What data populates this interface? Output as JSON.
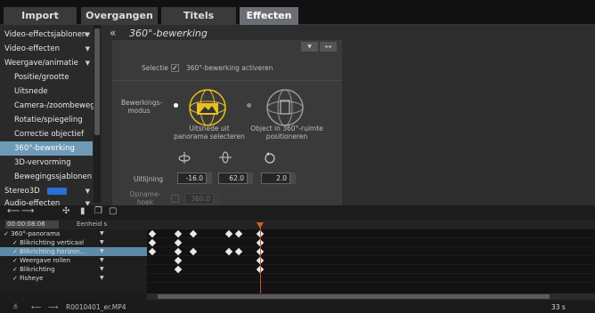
{
  "tabs": [
    "Import",
    "Overgangen",
    "Titels",
    "Effecten"
  ],
  "sidebar": {
    "items": [
      {
        "label": "Video-effectsjablonen",
        "arrow": "▼"
      },
      {
        "label": "Video-effecten",
        "arrow": "▼"
      },
      {
        "label": "Weergave/animatie",
        "arrow": "▼"
      },
      {
        "label": "Positie/grootte"
      },
      {
        "label": "Uitsnede"
      },
      {
        "label": "Camera-/zoombeweg."
      },
      {
        "label": "Rotatie/spiegeling"
      },
      {
        "label": "Correctie objectief"
      },
      {
        "label": "360°-bewerking",
        "selected": true
      },
      {
        "label": "3D-vervorming"
      },
      {
        "label": "Bewegingssjablonen"
      },
      {
        "label": "Stereo3D",
        "arrow": "▼"
      },
      {
        "label": "Audio-effecten",
        "arrow": "▼"
      }
    ]
  },
  "panel": {
    "collapse_glyph": "«",
    "title": "360°-bewerking",
    "selectie_label": "Selectie",
    "activate_label": "360°-bewerking activeren",
    "mode_label": "Bewerkings-\nmodus",
    "option1": "Uitsnede uit\npanorama selecteren",
    "option2": "Object in 360°-ruimte\npositioneren",
    "uitlijning_label": "Uitlijning",
    "values": [
      "-16.0",
      "62.0",
      "2.0"
    ],
    "opname_label": "Opname-\nhoek",
    "opname_value": "360.0"
  },
  "timeline": {
    "time": "00:00:08:06",
    "unit_label": "Eenheid",
    "unit_value": "s",
    "rows": [
      {
        "label": "360°-panorama",
        "level": 0
      },
      {
        "label": "Blikrichting verticaal",
        "level": 1
      },
      {
        "label": "Blikrichting horizon...",
        "level": 1,
        "selected": true
      },
      {
        "label": "Weergave rollen",
        "level": 1
      },
      {
        "label": "Blikrichting",
        "level": 1
      },
      {
        "label": "Fisheye",
        "level": 1
      }
    ],
    "keyframes": [
      [
        6,
        35,
        52,
        92,
        103,
        127
      ],
      [
        6,
        35,
        127
      ],
      [
        6,
        35,
        52,
        92,
        103,
        127
      ],
      [
        35,
        127
      ],
      [
        35,
        127
      ],
      []
    ],
    "file_name": "R0010401_er.MP4",
    "duration": "33 s"
  },
  "colors": {
    "accent": "#6e9ab8",
    "yellow": "#e8c020",
    "playhead": "#e05a2a"
  }
}
